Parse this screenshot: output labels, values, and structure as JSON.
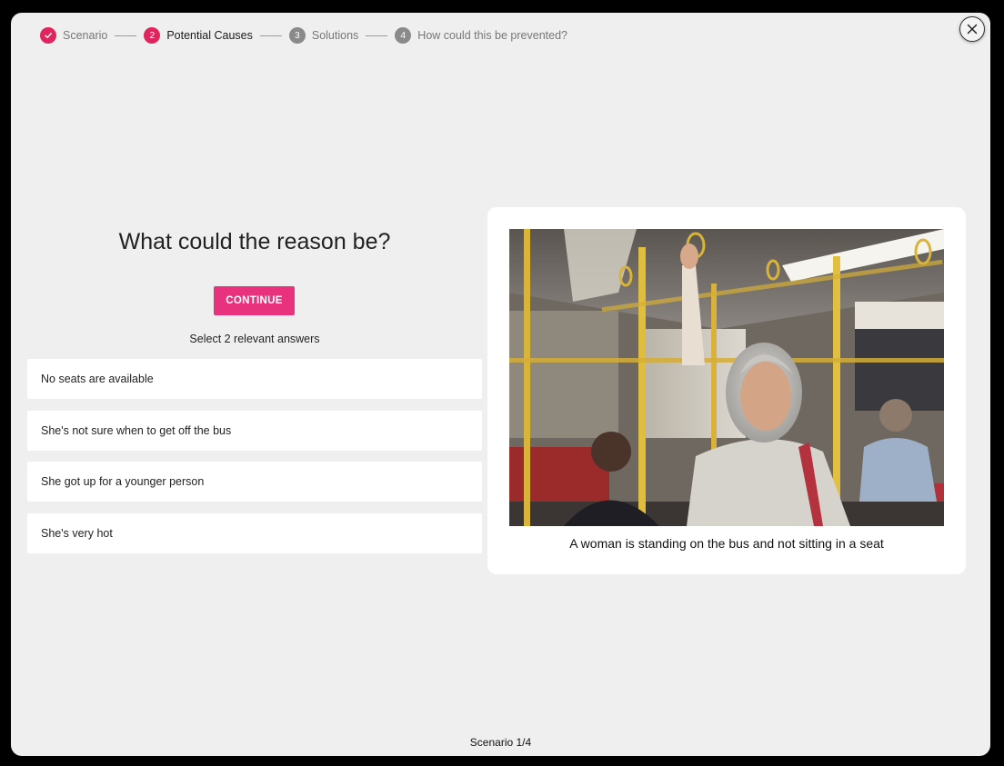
{
  "stepper": {
    "steps": [
      {
        "number": "",
        "label": "Scenario",
        "state": "completed",
        "icon": "checkmark-icon"
      },
      {
        "number": "2",
        "label": "Potential Causes",
        "state": "current"
      },
      {
        "number": "3",
        "label": "Solutions",
        "state": "upcoming"
      },
      {
        "number": "4",
        "label": "How could this be prevented?",
        "state": "upcoming"
      }
    ]
  },
  "close_button": {
    "icon": "close-icon"
  },
  "question": {
    "title": "What could the reason be?",
    "continue_label": "CONTINUE",
    "hint": "Select 2 relevant answers"
  },
  "answers": [
    {
      "label": "No seats are available"
    },
    {
      "label": "She's not sure when to get off the bus"
    },
    {
      "label": "She got up for a younger person"
    },
    {
      "label": "She's very hot"
    }
  ],
  "scenario_card": {
    "image": "photo-woman-standing-on-bus",
    "caption": "A woman is standing on the bus and not sitting in a seat"
  },
  "footer": {
    "progress": "Scenario 1/4"
  },
  "colors": {
    "accent": "#e8327e",
    "step_active": "#e0245e",
    "step_inactive": "#8a8a8a",
    "background": "#efefef",
    "card": "#ffffff"
  }
}
